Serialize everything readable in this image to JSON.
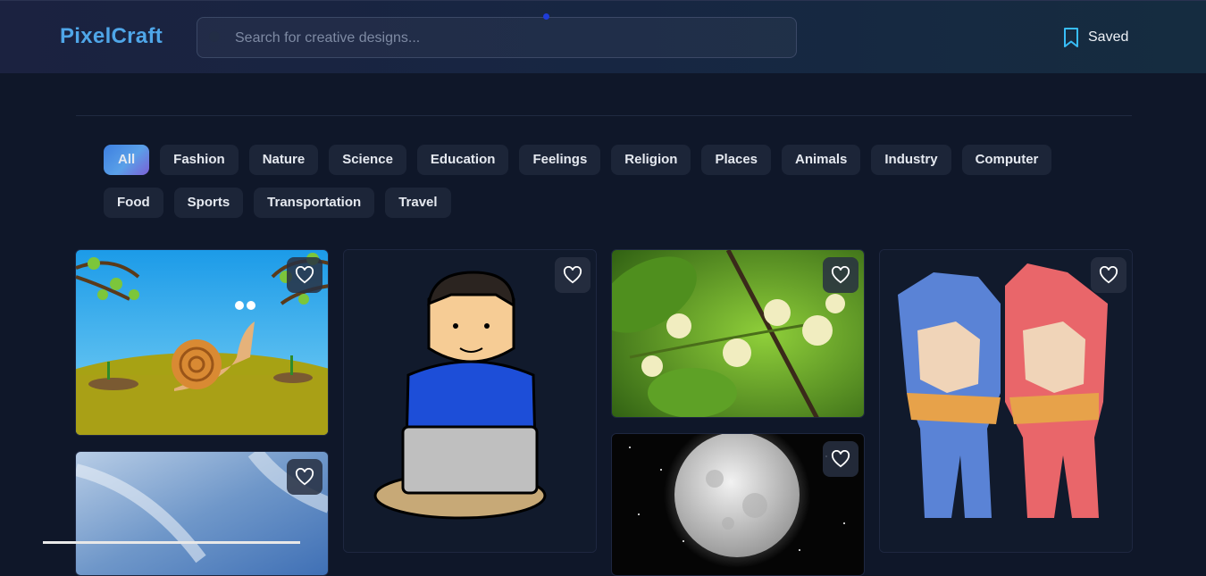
{
  "header": {
    "logo": "PixelCraft",
    "search_placeholder": "Search for creative designs...",
    "saved_label": "Saved"
  },
  "categories": [
    {
      "label": "All",
      "active": true
    },
    {
      "label": "Fashion"
    },
    {
      "label": "Nature"
    },
    {
      "label": "Science"
    },
    {
      "label": "Education"
    },
    {
      "label": "Feelings"
    },
    {
      "label": "Religion"
    },
    {
      "label": "Places"
    },
    {
      "label": "Animals"
    },
    {
      "label": "Industry"
    },
    {
      "label": "Computer"
    },
    {
      "label": "Food"
    },
    {
      "label": "Sports"
    },
    {
      "label": "Transportation"
    },
    {
      "label": "Travel"
    }
  ],
  "gallery": [
    {
      "image": "cartoon-snail-meadow",
      "heart_icon": "heart-outline-icon"
    },
    {
      "image": "boy-with-laptop-illustration",
      "heart_icon": "heart-outline-icon"
    },
    {
      "image": "white-blossoms-green-leaves",
      "heart_icon": "heart-outline-icon"
    },
    {
      "image": "low-poly-couple-hoodies",
      "heart_icon": "heart-outline-icon"
    },
    {
      "image": "blue-sky-clouds",
      "heart_icon": "heart-outline-icon"
    },
    {
      "image": "full-moon-night",
      "heart_icon": "heart-outline-icon"
    }
  ],
  "colors": {
    "background": "#0f1729",
    "logo": "#4fa6e8",
    "accent_gradient_start": "#3d7fe0",
    "accent_gradient_end": "#7b5fd6",
    "chip_bg": "#1c2538"
  }
}
